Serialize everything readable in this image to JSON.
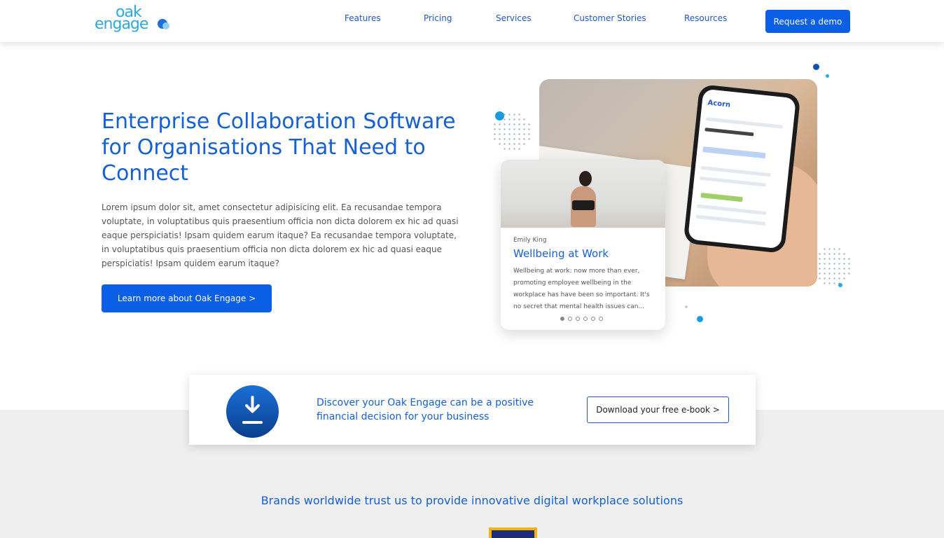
{
  "header": {
    "logo_top": "oak",
    "logo_bottom": "engage",
    "nav": [
      "Features",
      "Pricing",
      "Services",
      "Customer Stories",
      "Resources"
    ],
    "cta": "Request a demo"
  },
  "hero": {
    "title": "Enterprise Collaboration Software for Organisations That Need to Connect",
    "text": "Lorem ipsum dolor sit, amet consectetur adipisicing elit. Ea recusandae tempora voluptate, in voluptatibus quis praesentium officia non dicta dolorem ex hic ad quasi eaque perspiciatis! Ipsam quidem earum itaque? Ea recusandae tempora voluptate, in voluptatibus quis praesentium officia non dicta dolorem ex hic ad quasi eaque perspiciatis! Ipsam quidem earum itaque?",
    "button": "Learn more about Oak Engage >"
  },
  "phone": {
    "app_name": "Acorn"
  },
  "card": {
    "author": "Emily King",
    "title": "Wellbeing at Work",
    "text": "Wellbeing at work: now more than ever, promoting employee wellbeing in the workplace has have been so important. It's no secret that mental health issues can...",
    "pages": 6,
    "active_page": 1
  },
  "banner": {
    "icon": "download-icon",
    "text": "Discover your Oak Engage can be a positive financial decision for your business",
    "button": "Download your free e-book >"
  },
  "trust": {
    "heading": "Brands worldwide trust us to provide innovative digital workplace solutions"
  },
  "colors": {
    "primary": "#0b5ee6",
    "heading": "#1560d4",
    "accent": "#2baae1"
  }
}
